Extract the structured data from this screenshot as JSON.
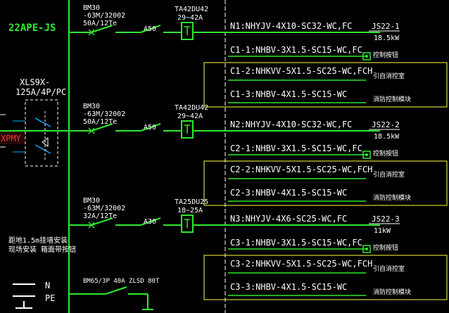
{
  "panel": {
    "id": "22APE-JS",
    "main_switch": [
      "XLS9X-",
      "125A/4P/PC"
    ],
    "source_tag": "XPMY",
    "install_note": [
      "距地1.5m挂墙安装",
      "现场安装  箱面带按钮"
    ],
    "spd": "BM65/3P 40A ZLSD 80T",
    "bus_labels": [
      "N",
      "PE"
    ]
  },
  "circuits": [
    {
      "breaker": [
        "BM30",
        "-63M/32002",
        "50A/12Te"
      ],
      "rating": "A50",
      "ct": [
        "TA42DU42",
        "29~42A"
      ],
      "main_cable": "N1:NHYJV-4X10-SC32-WC,FC",
      "load_id": "JS22-1",
      "load_kw": "18.5kW",
      "sub": [
        {
          "text": "C1-1:NHBV-3X1.5-SC15-WC,FC",
          "note": "控制按钮"
        },
        {
          "text": "C1-2:NHKVV-5X1.5-SC25-WC,FCH",
          "note": "引自消控室"
        },
        {
          "text": "C1-3:NHBV-4X1.5-SC15-WC",
          "note": "消防控制模块"
        }
      ]
    },
    {
      "breaker": [
        "BM30",
        "-63M/32002",
        "50A/12Te"
      ],
      "rating": "A50",
      "ct": [
        "TA42DU42",
        "29~42A"
      ],
      "main_cable": "N2:NHYJV-4X10-SC32-WC,FC",
      "load_id": "JS22-2",
      "load_kw": "18.5kW",
      "sub": [
        {
          "text": "C2-1:NHBV-3X1.5-SC15-WC,FC",
          "note": "控制按钮"
        },
        {
          "text": "C2-2:NHKVV-5X1.5-SC25-WC,FCH",
          "note": "引自消控室"
        },
        {
          "text": "C2-3:NHBV-4X1.5-SC15-WC",
          "note": "消防控制模块"
        }
      ]
    },
    {
      "breaker": [
        "BM30",
        "-63M/32002",
        "32A/12Te"
      ],
      "rating": "A30",
      "ct": [
        "TA25DU25",
        "18~25A"
      ],
      "main_cable": "N3:NHYJV-4X6-SC25-WC,FC",
      "load_id": "JS22-3",
      "load_kw": "11kW",
      "sub": [
        {
          "text": "C3-1:NHBV-3X1.5-SC15-WC,FC",
          "note": "控制按钮"
        },
        {
          "text": "C3-2:NHKVV-5X1.5-SC25-WC,FCH",
          "note": "引自消控室"
        },
        {
          "text": "C3-3:NHBV-4X1.5-SC15-WC",
          "note": "消防控制模块"
        }
      ]
    }
  ],
  "colors": {
    "background": "#000000",
    "text": "#ffffff",
    "wire": "#2ee82e",
    "frame": "#ffff40",
    "source": "#ff3030",
    "box": "#00b0ff"
  }
}
